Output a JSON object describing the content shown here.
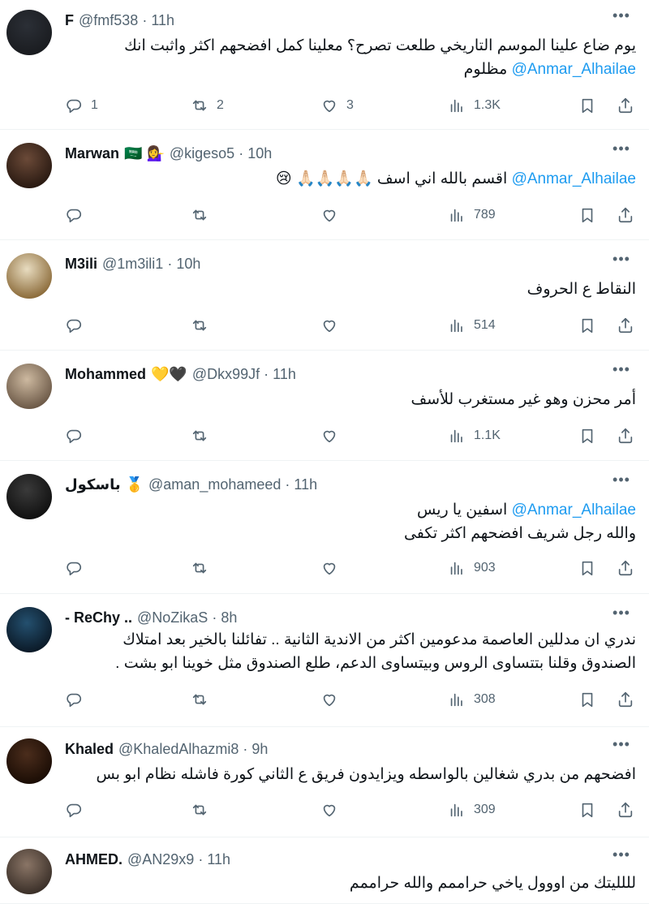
{
  "tweets": [
    {
      "name": "F",
      "badges": "",
      "handle": "@fmf538",
      "time": "11h",
      "lines": [
        {
          "text": "يوم ضاع علينا الموسم التاريخي طلعت تصرح؟ معلينا كمل افضحهم اكثر واثبت انك",
          "mention": ""
        },
        {
          "text": "مظلوم",
          "mention": "@Anmar_Alhailae"
        }
      ],
      "replies": "1",
      "reposts": "2",
      "likes": "3",
      "views": "1.3K"
    },
    {
      "name": "Marwan",
      "badges": "🇸🇦 💁‍♀️",
      "handle": "@kigeso5",
      "time": "10h",
      "lines": [
        {
          "text": "اقسم بالله اني اسف 🙏🏻🙏🏻🙏🏻🙏🏻 😢",
          "mention": "@Anmar_Alhailae"
        }
      ],
      "replies": "",
      "reposts": "",
      "likes": "",
      "views": "789"
    },
    {
      "name": "M3ili",
      "badges": "",
      "handle": "@1m3ili1",
      "time": "10h",
      "lines": [
        {
          "text": "النقاط ع الحروف",
          "mention": ""
        }
      ],
      "replies": "",
      "reposts": "",
      "likes": "",
      "views": "514"
    },
    {
      "name": "Mohammed",
      "badges": "💛🖤",
      "handle": "@Dkx99Jf",
      "time": "11h",
      "lines": [
        {
          "text": "أمر محزن وهو غير مستغرب للأسف",
          "mention": ""
        }
      ],
      "replies": "",
      "reposts": "",
      "likes": "",
      "views": "1.1K"
    },
    {
      "name": "باسكول",
      "badges": "🥇",
      "handle": "@aman_mohameed",
      "time": "11h",
      "lines": [
        {
          "text": "اسفين يا ريس",
          "mention": "@Anmar_Alhailae"
        },
        {
          "text": "والله رجل شريف افضحهم اكثر تكفى",
          "mention": ""
        }
      ],
      "replies": "",
      "reposts": "",
      "likes": "",
      "views": "903"
    },
    {
      "name": "- ReChy ..",
      "badges": "",
      "handle": "@NoZikaS",
      "time": "8h",
      "lines": [
        {
          "text": "ندري ان مدللين العاصمة مدعومين اكثر من الاندية الثانية .. تفائلنا بالخير بعد امتلاك",
          "mention": ""
        },
        {
          "text": "الصندوق وقلنا بتتساوى الروس وبيتساوى الدعم، طلع الصندوق مثل خوينا ابو بشت .",
          "mention": ""
        }
      ],
      "replies": "",
      "reposts": "",
      "likes": "",
      "views": "308"
    },
    {
      "name": "Khaled",
      "badges": "",
      "handle": "@KhaledAlhazmi8",
      "time": "9h",
      "lines": [
        {
          "text": "افضحهم من بدري شغالين بالواسطه ويزايدون فريق ع الثاني كورة فاشله نظام ابو بس",
          "mention": ""
        }
      ],
      "replies": "",
      "reposts": "",
      "likes": "",
      "views": "309"
    },
    {
      "name": "AHMED.",
      "badges": "",
      "handle": "@AN29x9",
      "time": "11h",
      "lines": [
        {
          "text": "لللليتك من اووول ياخي حراممم والله حراممم",
          "mention": ""
        }
      ],
      "replies": "",
      "reposts": "",
      "likes": "",
      "views": ""
    }
  ],
  "dot": "·",
  "icons": {
    "more": "more-dots-icon",
    "reply": "reply-icon",
    "repost": "repost-icon",
    "like": "heart-icon",
    "views": "views-icon",
    "bookmark": "bookmark-icon",
    "share": "share-icon"
  },
  "colors": {
    "text": "#0f1419",
    "muted": "#536471",
    "link": "#1d9bf0",
    "divider": "#eff3f4"
  }
}
